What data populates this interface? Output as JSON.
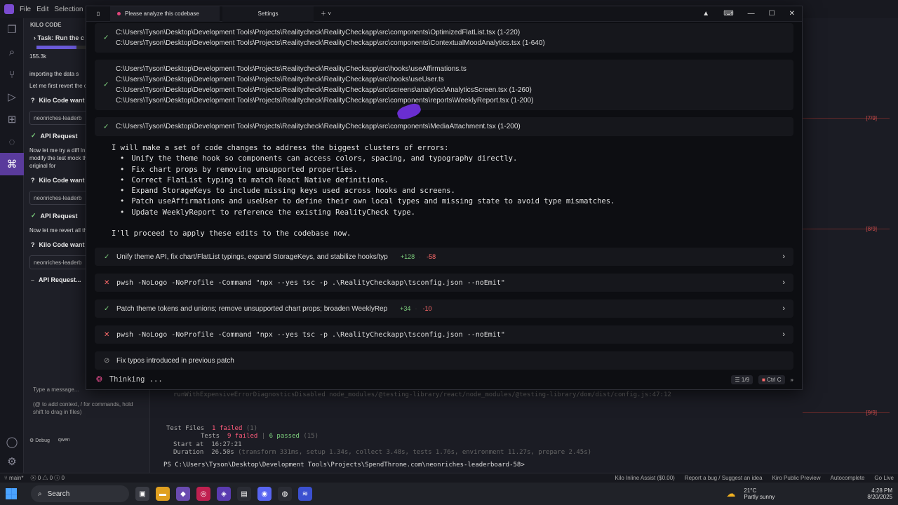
{
  "ide": {
    "menu": [
      "File",
      "Edit",
      "Selection"
    ],
    "panel_title": "KILO CODE"
  },
  "kilo_panel": {
    "task_label": "Task: Run the c",
    "tokens": "155.3k",
    "msg1": "importing the data s",
    "msg2": "Let me first revert the original form:",
    "kilo_wants_1": "Kilo Code want",
    "field_1": "neonriches-leaderb",
    "api_request_1": "API Request",
    "msg3": "Now let me try a diff Instead of using ... let me modify the test mock the module. Let file to its original for",
    "kilo_wants_2": "Kilo Code want",
    "field_2": "neonriches-leaderb",
    "api_request_2": "API Request",
    "msg4": "Now let me revert all the test file:",
    "kilo_wants_3": "Kilo Code want",
    "field_3": "neonriches-leaderb",
    "api_request_3": "API Request...",
    "input_placeholder": "Type a message...",
    "input_hint": "(@ to add context, / for commands, hold shift to drag in files)",
    "mode_button": "Debug",
    "model_label": "qwen"
  },
  "editor": {
    "diff_marks": [
      "[7/9]",
      "[8/9]",
      "[9/9]"
    ],
    "terminal": {
      "faded_line": "runWithExpensiveErrorDiagnosticsDisabled node_modules/@testing-library/react/node_modules/@testing-library/dom/dist/config.js:47:12",
      "test_files_label": "Test Files",
      "test_files_value": "1 failed",
      "test_files_total": "(1)",
      "tests_label": "Tests",
      "tests_failed": "9 failed",
      "tests_passed": "6 passed",
      "tests_total": "(15)",
      "start_label": "Start at",
      "start_value": "16:27:21",
      "duration_label": "Duration",
      "duration_value": "26.50s",
      "duration_detail": "(transform 331ms, setup 1.34s, collect 3.48s, tests 1.76s, environment 11.27s, prepare 2.45s)",
      "prompt": "PS C:\\Users\\Tyson\\Desktop\\Development Tools\\Projects\\SpendThrone.com\\neonriches-leaderboard-58>"
    }
  },
  "window": {
    "tab_active": "Please analyze this codebase",
    "tab_settings": "Settings",
    "cards": [
      {
        "status": "ok",
        "lines": [
          "C:\\Users\\Tyson\\Desktop\\Development Tools\\Projects\\Realitycheck\\RealityCheckapp\\src\\components\\OptimizedFlatList.tsx (1-220)",
          "C:\\Users\\Tyson\\Desktop\\Development Tools\\Projects\\Realitycheck\\RealityCheckapp\\src\\components\\ContextualMoodAnalytics.tsx (1-640)"
        ]
      },
      {
        "status": "ok",
        "lines": [
          "C:\\Users\\Tyson\\Desktop\\Development Tools\\Projects\\Realitycheck\\RealityCheckapp\\src\\hooks\\useAffirmations.ts",
          "C:\\Users\\Tyson\\Desktop\\Development Tools\\Projects\\Realitycheck\\RealityCheckapp\\src\\hooks\\useUser.ts",
          "C:\\Users\\Tyson\\Desktop\\Development Tools\\Projects\\Realitycheck\\RealityCheckapp\\src\\screens\\analytics\\AnalyticsScreen.tsx (1-260)",
          "C:\\Users\\Tyson\\Desktop\\Development Tools\\Projects\\Realitycheck\\RealityCheckapp\\src\\components\\reports\\WeeklyReport.tsx (1-200)"
        ]
      },
      {
        "status": "ok",
        "lines": [
          "C:\\Users\\Tyson\\Desktop\\Development Tools\\Projects\\Realitycheck\\RealityCheckapp\\src\\components\\MediaAttachment.tsx (1-200)"
        ]
      }
    ],
    "plan_intro": "I will make a set of code changes to address the biggest clusters of errors:",
    "plan_items": [
      "Unify the theme hook so components can access colors, spacing, and typography directly.",
      "Fix chart props by removing unsupported properties.",
      "Correct FlatList typing to match React Native definitions.",
      "Expand StorageKeys to include missing keys used across hooks and screens.",
      "Patch useAffirmations and useUser to define their own local types and missing state to avoid type mismatches.",
      "Update WeeklyReport to reference the existing RealityCheck type."
    ],
    "plan_outro": "I'll proceed to apply these edits to the codebase now.",
    "actions": [
      {
        "status": "ok",
        "text": "Unify theme API, fix chart/FlatList typings, expand StorageKeys, and stabilize hooks/typ",
        "add": "+128",
        "del": "-58",
        "mono": false
      },
      {
        "status": "bad",
        "text": "pwsh -NoLogo -NoProfile -Command \"npx --yes tsc -p .\\RealityCheckapp\\tsconfig.json --noEmit\"",
        "add": "",
        "del": "",
        "mono": true
      },
      {
        "status": "ok",
        "text": "Patch theme tokens and unions; remove unsupported chart props; broaden WeeklyRep",
        "add": "+34",
        "del": "-10",
        "mono": false
      },
      {
        "status": "bad",
        "text": "pwsh -NoLogo -NoProfile -Command \"npx --yes tsc -p .\\RealityCheckapp\\tsconfig.json --noEmit\"",
        "add": "",
        "del": "",
        "mono": true
      }
    ],
    "pending": "Fix typos introduced in previous patch",
    "thinking": "Thinking ...",
    "counter": "1/9",
    "stop_label": "Ctrl C"
  },
  "status_bar": {
    "branch": "main*",
    "errors": "0",
    "warnings": "0",
    "info": "0",
    "right": [
      "Kilo Inline Assist ($0.00)",
      "Report a bug / Suggest an idea",
      "Kiro Public Preview",
      "Autocomplete",
      "Go Live"
    ]
  },
  "taskbar": {
    "search": "Search",
    "weather_temp": "21°C",
    "weather_desc": "Partly sunny",
    "time": "4:28 PM",
    "date": "8/20/2025"
  }
}
